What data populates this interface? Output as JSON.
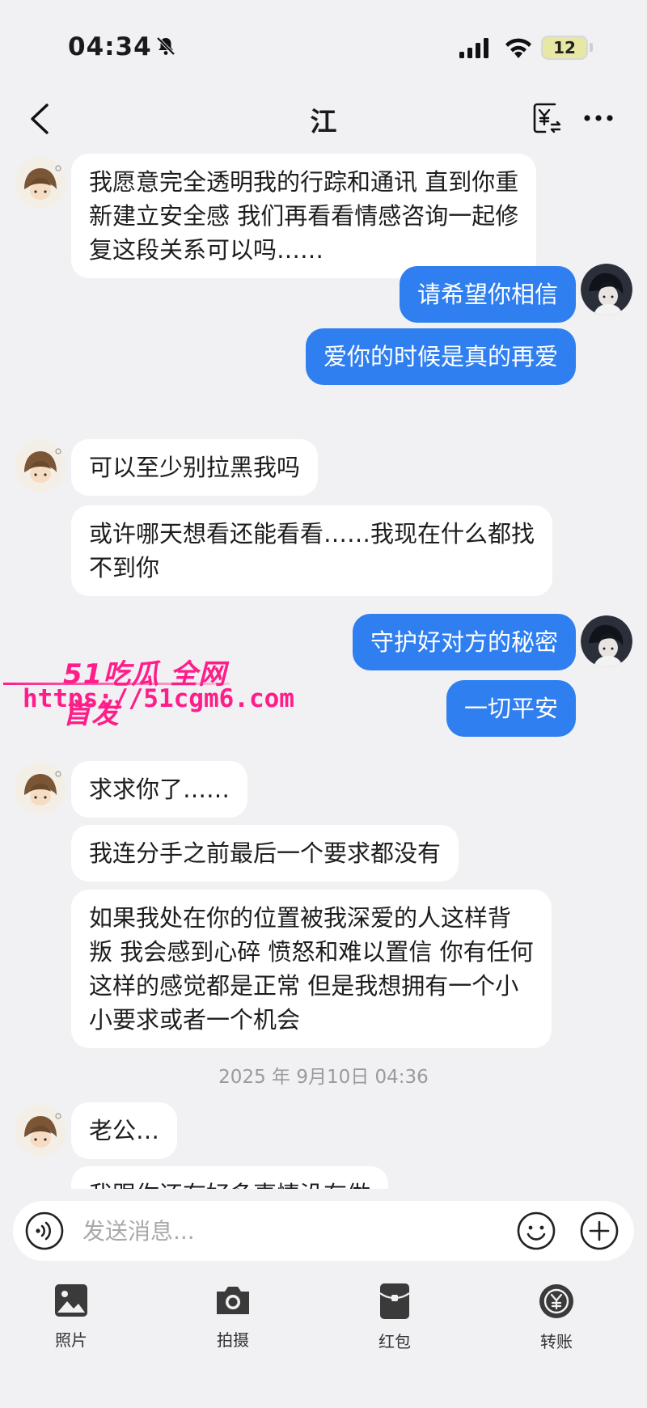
{
  "status": {
    "time": "04:34",
    "battery": "12"
  },
  "header": {
    "title": "江"
  },
  "messages": [
    {
      "dir": "in",
      "text": "我愿意完全透明我的行踪和通讯 直到你重\n新建立安全感 我们再看看情感咨询一起修\n复这段关系可以吗……"
    },
    {
      "dir": "out",
      "text": "请希望你相信"
    },
    {
      "dir": "out",
      "text": "爱你的时候是真的再爱"
    },
    {
      "dir": "in",
      "text": "可以至少别拉黑我吗"
    },
    {
      "dir": "in",
      "text": "或许哪天想看还能看看……我现在什么都找\n不到你"
    },
    {
      "dir": "out",
      "text": "守护好对方的秘密"
    },
    {
      "dir": "out",
      "text": "一切平安"
    },
    {
      "dir": "in",
      "text": "求求你了……"
    },
    {
      "dir": "in",
      "text": "我连分手之前最后一个要求都没有"
    },
    {
      "dir": "in",
      "text": "如果我处在你的位置被我深爱的人这样背\n叛 我会感到心碎 愤怒和难以置信 你有任何\n这样的感觉都是正常 但是我想拥有一个小\n小要求或者一个机会"
    },
    {
      "dir": "in",
      "text": "老公…"
    },
    {
      "dir": "in",
      "text": "我跟你还有好多事情没有做"
    }
  ],
  "timestamp": "2025 年 9月10日 04:36",
  "watermark": {
    "brand": "51吃瓜 全网首发",
    "url": "https://51cgm6.com"
  },
  "input": {
    "placeholder": "发送消息..."
  },
  "toolbar": [
    {
      "label": "照片",
      "icon": "photo-icon"
    },
    {
      "label": "拍摄",
      "icon": "camera-icon"
    },
    {
      "label": "红包",
      "icon": "red-packet-icon"
    },
    {
      "label": "转账",
      "icon": "transfer-icon"
    }
  ],
  "colors": {
    "outgoing_bubble": "#2f7ff0",
    "incoming_bubble": "#ffffff",
    "background": "#f1f1f3",
    "watermark": "#ff1d8a"
  }
}
